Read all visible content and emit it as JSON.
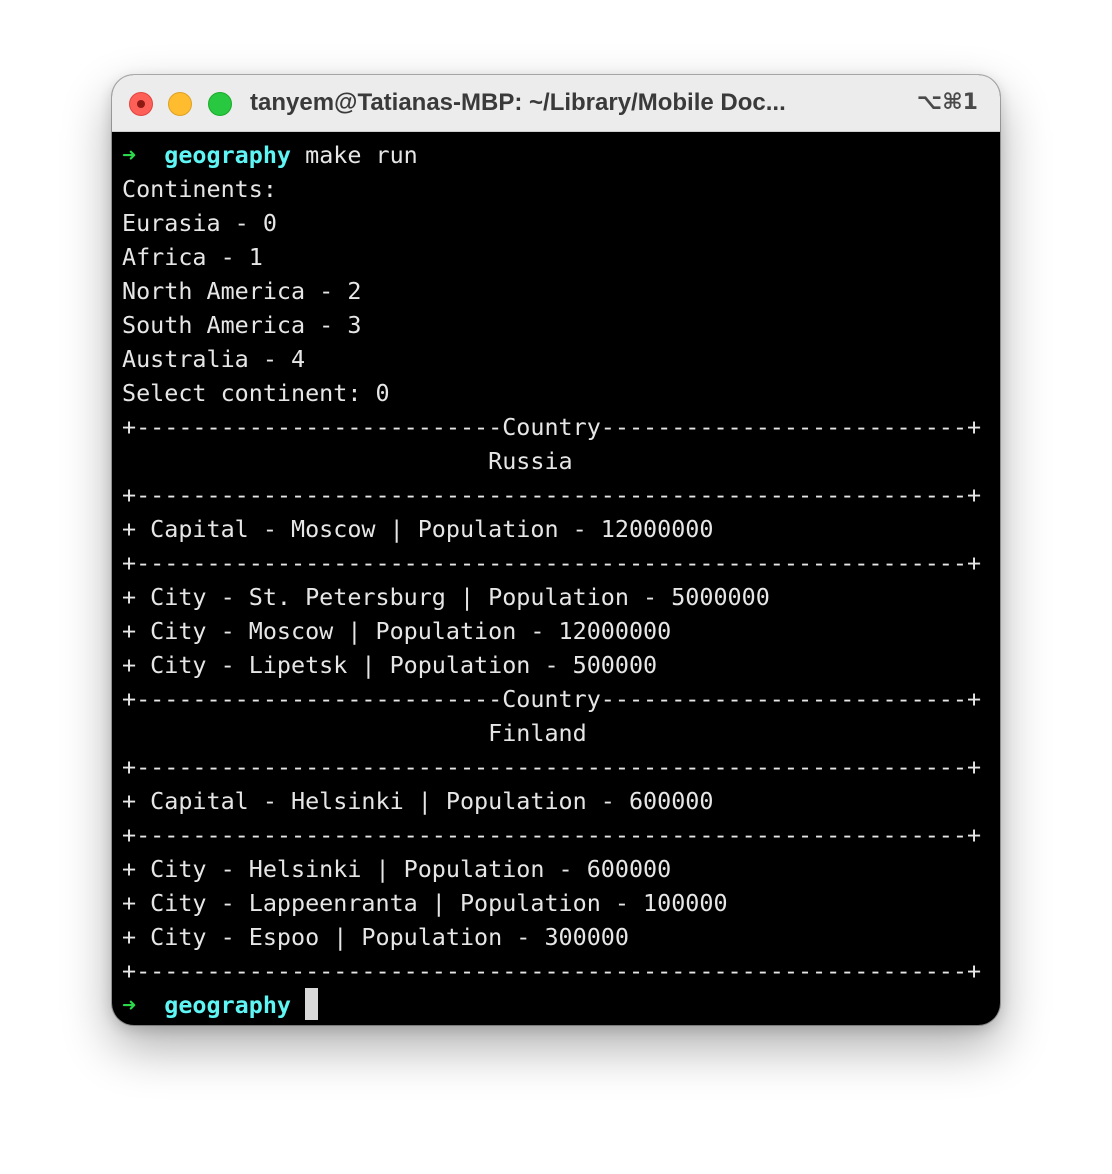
{
  "window": {
    "title": "tanyem@Tatianas-MBP: ~/Library/Mobile Doc...",
    "shortcut": "⌥⌘1"
  },
  "prompt": {
    "arrow": "➜",
    "directory": "geography",
    "command": "make run"
  },
  "output": [
    "Continents:",
    "Eurasia - 0",
    "Africa - 1",
    "North America - 2",
    "South America - 3",
    "Australia - 4",
    "Select continent: 0",
    "+--------------------------Country--------------------------+",
    "                          Russia",
    "+-----------------------------------------------------------+",
    "+ Capital - Moscow | Population - 12000000",
    "+-----------------------------------------------------------+",
    "+ City - St. Petersburg | Population - 5000000",
    "+ City - Moscow | Population - 12000000",
    "+ City - Lipetsk | Population - 500000",
    "+--------------------------Country--------------------------+",
    "                          Finland",
    "+-----------------------------------------------------------+",
    "+ Capital - Helsinki | Population - 600000",
    "+-----------------------------------------------------------+",
    "+ City - Helsinki | Population - 600000",
    "+ City - Lappeenranta | Population - 100000",
    "+ City - Espoo | Population - 300000",
    "+-----------------------------------------------------------+"
  ],
  "colors": {
    "prompt_arrow": "#2bd84a",
    "directory": "#5ff5f5",
    "text": "#e6e6e6",
    "background": "#000000"
  }
}
